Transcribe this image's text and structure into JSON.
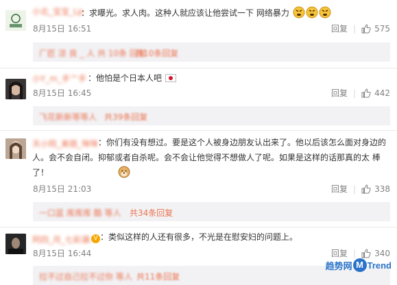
{
  "comments": [
    {
      "username": "小北_宝宝_Lp",
      "text": "：求曝光。求人肉。这种人就应该让他尝试一下 网络暴力",
      "date": "8月15日 16:51",
      "reply_label": "回复",
      "like_count": "575",
      "reply_preview": "厂匠 凉 良 _ 人 共 10条 回复",
      "reply_count_text": "共10条回复"
    },
    {
      "username": "小Y_m_手亠手",
      "text": "：他怕是个日本人吧",
      "date": "8月15日 16:45",
      "reply_label": "回复",
      "like_count": "442",
      "reply_preview": "飞花新新等等人",
      "reply_count_text": "共39条回复"
    },
    {
      "username": "天小院_美丽_咪咪",
      "text": "：你们有没有想过。要是这个人被身边朋友认出来了。他以后该怎么面对身边的人。会不会自闭。抑郁或者自杀呢。会不会让他觉得不想做人了呢。如果是这样的话那真的太 棒了！",
      "date": "8月15日 21:03",
      "reply_label": "回复",
      "like_count": "338",
      "reply_preview": "一口蓝 库库库 酷 等人",
      "reply_count_text": "共34条回复"
    },
    {
      "username": "阿四_月_七彩漏",
      "text": "：类似这样的人还有很多，不光是在慰安妇的问题上。",
      "date": "8月15日 16:44",
      "reply_label": "回复",
      "like_count": "340",
      "reply_preview": "拉不过自己拉不过你 等人",
      "reply_count_text": "共11条回复"
    }
  ],
  "watermark": {
    "left": "趋势网",
    "m": "M",
    "right": "Trend"
  },
  "colors": {
    "link": "#eb7350",
    "muted": "#808080",
    "reply_bg": "#f2f2f5",
    "watermark": "#2a73c9"
  }
}
